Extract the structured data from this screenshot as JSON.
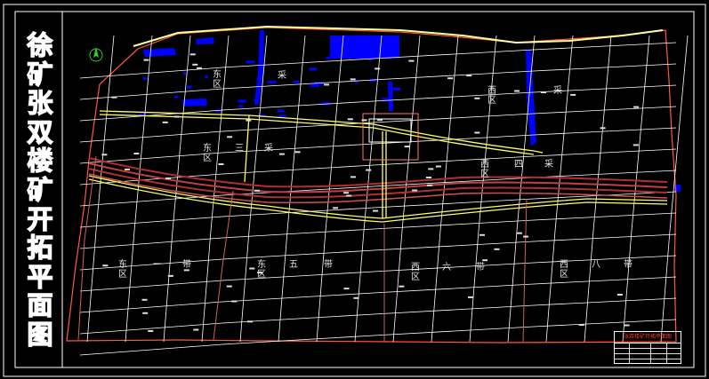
{
  "drawing": {
    "title_chars": [
      "徐",
      "矿",
      "张",
      "双",
      "楼",
      "矿",
      "开",
      "拓",
      "平",
      "面",
      "图"
    ],
    "colors": {
      "background": "#000000",
      "frame": "#ffffff",
      "grid": "#ffffff",
      "boundary": "#ff5a3c",
      "roadway": "#ffff66",
      "water": "#0000ff",
      "fault_band": "#b03030",
      "north_arrow": "#33cc33"
    }
  },
  "zones": [
    {
      "id": "zone-north-a",
      "chars": [
        "东",
        "区"
      ]
    },
    {
      "id": "zone-north-a-2",
      "chars": [
        "采"
      ]
    },
    {
      "id": "zone-north-west",
      "chars": [
        "西",
        "区"
      ]
    },
    {
      "id": "zone-north-west-2",
      "chars": [
        "采"
      ]
    },
    {
      "id": "zone-east-3",
      "chars": [
        "东",
        "区"
      ]
    },
    {
      "id": "zone-east-3-b",
      "chars": [
        "三"
      ]
    },
    {
      "id": "zone-east-3-c",
      "chars": [
        "采"
      ]
    },
    {
      "id": "zone-west-4",
      "chars": [
        "西",
        "区"
      ]
    },
    {
      "id": "zone-west-4-b",
      "chars": [
        "四"
      ]
    },
    {
      "id": "zone-west-4-c",
      "chars": [
        "采"
      ]
    },
    {
      "id": "zone-east-ext",
      "chars": [
        "东",
        "区"
      ]
    },
    {
      "id": "zone-east-ext-b",
      "chars": [
        "一"
      ]
    },
    {
      "id": "zone-east-ext-c",
      "chars": [
        "带"
      ]
    },
    {
      "id": "zone-east-5",
      "chars": [
        "东",
        "区"
      ]
    },
    {
      "id": "zone-east-5-b",
      "chars": [
        "五"
      ]
    },
    {
      "id": "zone-east-5-c",
      "chars": [
        "带"
      ]
    },
    {
      "id": "zone-west-6",
      "chars": [
        "西",
        "区"
      ]
    },
    {
      "id": "zone-west-6-b",
      "chars": [
        "六"
      ]
    },
    {
      "id": "zone-west-6-c",
      "chars": [
        "带"
      ]
    },
    {
      "id": "zone-west-8",
      "chars": [
        "西",
        "区"
      ]
    },
    {
      "id": "zone-west-8-b",
      "chars": [
        "八"
      ]
    },
    {
      "id": "zone-west-8-c",
      "chars": [
        "带"
      ]
    }
  ],
  "title_block": {
    "heading": "张双楼矿开拓平面图"
  }
}
